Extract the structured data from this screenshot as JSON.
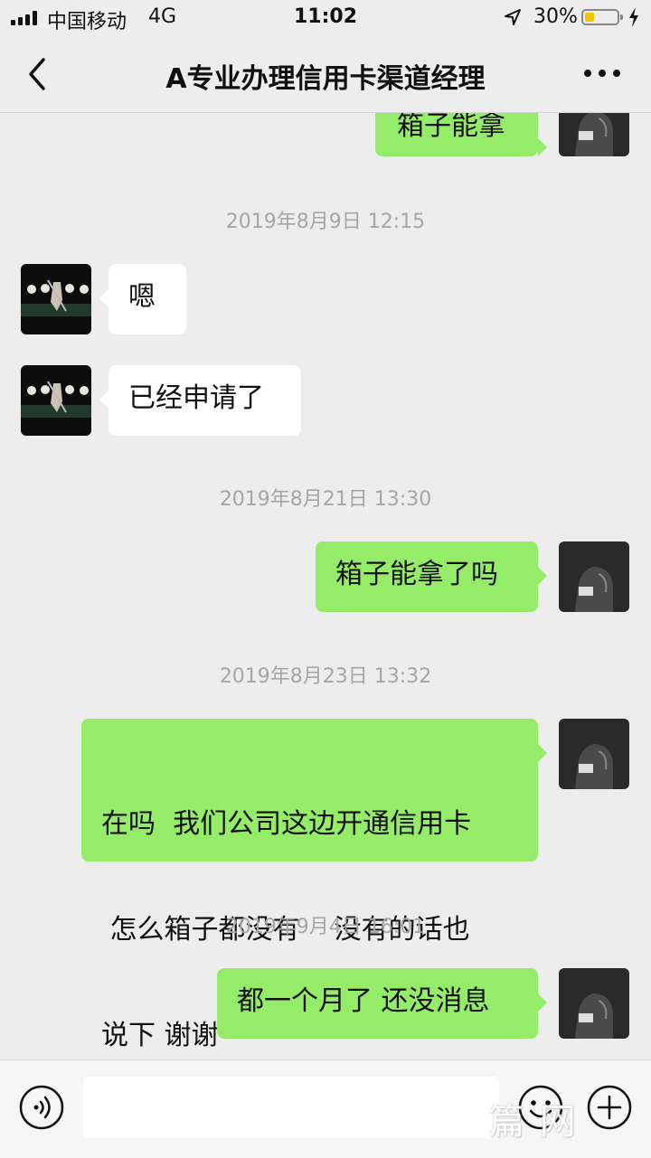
{
  "status_bar": {
    "carrier": "中国移动",
    "network": "4G",
    "time": "11:02",
    "battery_percent": "30%",
    "battery_level": 0.3,
    "icons": [
      "signal-icon",
      "location-arrow-icon",
      "battery-icon",
      "charging-icon"
    ]
  },
  "nav": {
    "title": "A专业办理信用卡渠道经理",
    "icons": [
      "back-chevron-icon",
      "more-dots-icon"
    ]
  },
  "messages": [
    {
      "type": "sent",
      "text": "箱子能拿"
    },
    {
      "type": "time",
      "text": "2019年8月9日 12:15"
    },
    {
      "type": "received",
      "text": "嗯"
    },
    {
      "type": "received",
      "text": "已经申请了"
    },
    {
      "type": "time",
      "text": "2019年8月21日 13:30"
    },
    {
      "type": "sent",
      "text": "箱子能拿了吗"
    },
    {
      "type": "time",
      "text": "2019年8月23日 13:32"
    },
    {
      "type": "sent",
      "lines": [
        "在吗  我们公司这边开通信用卡",
        " 怎么箱子都没有    没有的话也",
        "说下 谢谢"
      ]
    },
    {
      "type": "time",
      "text": "2019年9月4日 16:01"
    },
    {
      "type": "sent",
      "text": "都一个月了 还没消息"
    }
  ],
  "input_bar": {
    "input_value": "",
    "icons": [
      "voice-icon",
      "emoji-icon",
      "plus-icon"
    ]
  },
  "watermark": "篇 网",
  "colors": {
    "background": "#ededed",
    "sent_bubble": "#95ec69",
    "received_bubble": "#ffffff",
    "timestamp": "#a6a6a6",
    "battery": "#f3c300"
  }
}
